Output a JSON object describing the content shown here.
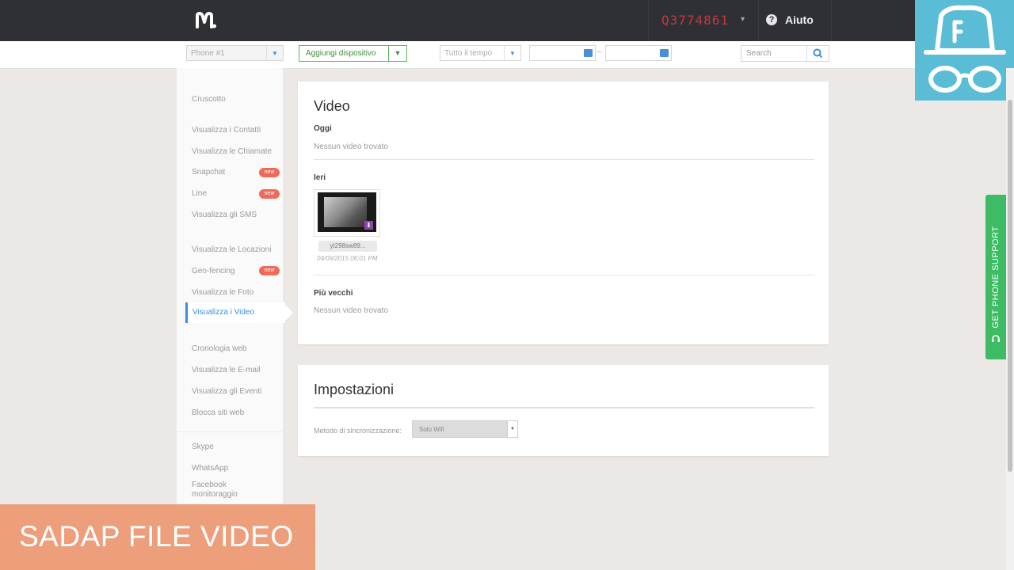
{
  "header": {
    "account_id": "Q3774861",
    "account_caret": "▾",
    "help_label": "Aiuto",
    "help_icon_glyph": "?"
  },
  "toolbar": {
    "device_select": "Phone #1",
    "add_device_label": "Aggiungi dispositivo",
    "time_select": "Tutto il tempo",
    "date_separator": "–",
    "search_placeholder": "Search"
  },
  "sidebar": {
    "items": [
      {
        "label": "Cruscotto"
      },
      {
        "label": "Visualizza i Contatti"
      },
      {
        "label": "Visualizza le Chiamate"
      },
      {
        "label": "Snapchat",
        "badge": "new"
      },
      {
        "label": "Line",
        "badge": "new"
      },
      {
        "label": "Visualizza gli SMS"
      },
      {
        "label": "Visualizza le Locazioni"
      },
      {
        "label": "Geo-fencing",
        "badge": "new"
      },
      {
        "label": "Visualizza le Foto"
      },
      {
        "label": "Visualizza i Video",
        "active": true
      },
      {
        "label": "Cronologia web"
      },
      {
        "label": "Visualizza le E-mail"
      },
      {
        "label": "Visualizza gli Eventi"
      },
      {
        "label": "Blocca siti web"
      },
      {
        "label": "Skype"
      },
      {
        "label": "WhatsApp"
      },
      {
        "label": "Facebook monitoraggio"
      }
    ]
  },
  "video_panel": {
    "title": "Video",
    "today_label": "Oggi",
    "today_empty": "Nessun video trovato",
    "yesterday_label": "Ieri",
    "video": {
      "filename": "yt298sw89...",
      "date": "04/09/2015 06:01 PM"
    },
    "older_label": "Più vecchi",
    "older_empty": "Nessun video trovato"
  },
  "settings_panel": {
    "title": "Impostazioni",
    "sync_label": "Metodo di sincronizzazione:",
    "sync_value": "Solo Wifi"
  },
  "support_tab": {
    "label": "GET PHONE SUPPORT"
  },
  "banner": {
    "text": "SADAP FILE VIDEO"
  },
  "colors": {
    "topbar": "#2f3036",
    "account_id": "#c0393b",
    "accent_blue": "#3b8fd9",
    "add_device_green": "#5cb85c",
    "badge": "#f06a5a",
    "support_tab": "#3dbb65",
    "banner": "#ed9e7b",
    "spy_logo_bg": "#5bbcd6"
  }
}
